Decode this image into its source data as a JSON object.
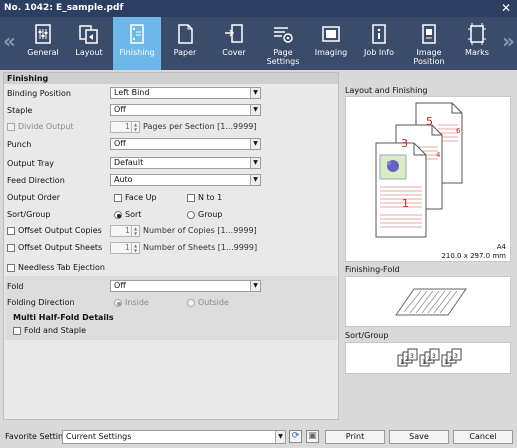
{
  "window": {
    "title": "No. 1042: E_sample.pdf",
    "close_glyph": "✕"
  },
  "tabs": [
    {
      "label": "General",
      "icon": "general-icon",
      "selected": false
    },
    {
      "label": "Layout",
      "icon": "layout-icon",
      "selected": false
    },
    {
      "label": "Finishing",
      "icon": "finishing-icon",
      "selected": true
    },
    {
      "label": "Paper",
      "icon": "paper-icon",
      "selected": false
    },
    {
      "label": "Cover",
      "icon": "cover-icon",
      "selected": false
    },
    {
      "label": "Page Settings",
      "icon": "page-settings-icon",
      "selected": false
    },
    {
      "label": "Imaging",
      "icon": "imaging-icon",
      "selected": false
    },
    {
      "label": "Job Info",
      "icon": "job-info-icon",
      "selected": false
    },
    {
      "label": "Image\nPosition",
      "icon": "image-position-icon",
      "selected": false
    },
    {
      "label": "Marks",
      "icon": "marks-icon",
      "selected": false
    }
  ],
  "nav": {
    "prev": "«",
    "next": "»"
  },
  "finishing": {
    "section_title": "Finishing",
    "binding_position": {
      "label": "Binding Position",
      "value": "Left Bind"
    },
    "staple": {
      "label": "Staple",
      "value": "Off"
    },
    "divide_output": {
      "label": "Divide Output",
      "value": "1",
      "suffix": "Pages per Section [1...9999]"
    },
    "punch": {
      "label": "Punch",
      "value": "Off"
    },
    "output_tray": {
      "label": "Output Tray",
      "value": "Default"
    },
    "feed_direction": {
      "label": "Feed Direction",
      "value": "Auto"
    },
    "output_order": {
      "label": "Output Order",
      "face_up": "Face Up",
      "n_to_1": "N to 1"
    },
    "sort_group": {
      "label": "Sort/Group",
      "sort": "Sort",
      "group": "Group",
      "selected": "Sort"
    },
    "offset_copies": {
      "label": "Offset Output Copies",
      "value": "1",
      "suffix": "Number of Copies [1...9999]"
    },
    "offset_sheets": {
      "label": "Offset Output Sheets",
      "value": "1",
      "suffix": "Number of Sheets [1...9999]"
    },
    "needless_tab": {
      "label": "Needless Tab Ejection"
    },
    "fold": {
      "label": "Fold",
      "value": "Off"
    },
    "folding_direction": {
      "label": "Folding Direction",
      "inside": "Inside",
      "outside": "Outside",
      "selected": "Inside"
    },
    "multi_half_fold": {
      "title": "Multi Half-Fold Details",
      "fold_and_staple": "Fold and Staple"
    }
  },
  "preview": {
    "layout_title": "Layout and Finishing",
    "page_numbers": [
      "5",
      "6",
      "3",
      "4",
      "1"
    ],
    "paper_size": "A4",
    "paper_dims": "210.0 x 297.0 mm",
    "fold_title": "Finishing-Fold",
    "sort_title": "Sort/Group",
    "sort_numbers": [
      "1",
      "2",
      "3",
      "1",
      "2",
      "3",
      "1",
      "2",
      "3"
    ]
  },
  "footer": {
    "favorite_label": "Favorite Setting",
    "favorite_value": "Current Settings",
    "refresh_icon": "refresh-icon",
    "save_favorite_icon": "save-icon",
    "print": "Print",
    "save": "Save",
    "cancel": "Cancel"
  },
  "colors": {
    "title_bar": "#2c3f63",
    "tab_bar": "#3b4b6a",
    "tab_selected": "#6db8e8",
    "page_number_red": "#cc2222"
  }
}
